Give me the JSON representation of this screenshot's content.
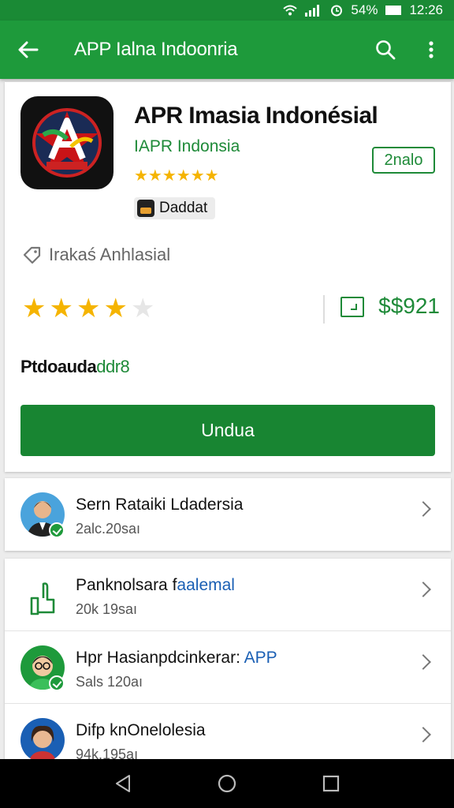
{
  "status_bar": {
    "battery": "54%",
    "time": "12:26"
  },
  "app_bar": {
    "title": "APP Ialna Indoonria"
  },
  "app": {
    "name": "APR Imasia Indonésial",
    "developer": "IAPR Indonsia",
    "age_rating": "2nalo",
    "small_stars": "★★★★★★",
    "chip_label": "Daddat",
    "favorite_label": "Irakaś Anhlasial",
    "rating_filled": 4,
    "rating_total": 5,
    "price": "$$921",
    "description_black": "Ptdoauda",
    "description_green": "ddr8",
    "install_label": "Undua"
  },
  "list_1": [
    {
      "title": "Sern Rataiki Ldadersia",
      "title_link": "",
      "subtitle": "2alc.20saı"
    }
  ],
  "list_2": [
    {
      "title": "Panknolsara f",
      "title_link": "aalemal",
      "subtitle": "20k 19saı"
    },
    {
      "title": "Hpr Hasianpdcinkerar: ",
      "title_link": "APP",
      "subtitle": "Sals 120aı"
    },
    {
      "title": "Difp knOnelolesia",
      "title_link": "",
      "subtitle": "94k.195aı"
    }
  ],
  "colors": {
    "primary": "#1e9a3b",
    "accent_star": "#f5b400",
    "link": "#1a5fb4"
  }
}
